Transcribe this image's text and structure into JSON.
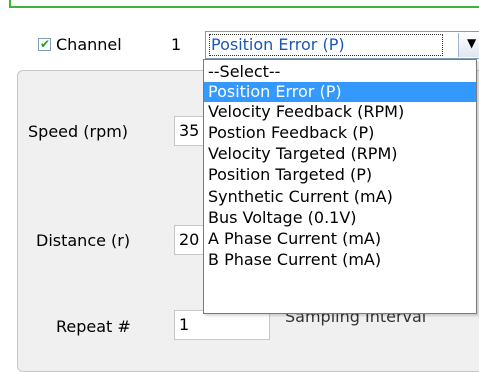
{
  "channel": {
    "checked": true,
    "label": "Channel",
    "number": "1",
    "selected_value": "Position Error (P)"
  },
  "dropdown": {
    "options": [
      "--Select--",
      "Position Error (P)",
      "Velocity Feedback (RPM)",
      "Postion Feedback (P)",
      "Velocity Targeted  (RPM)",
      "Position Targeted (P)",
      "Synthetic Current (mA)",
      "Bus Voltage (0.1V)",
      "A Phase Current (mA)",
      "B Phase Current (mA)"
    ],
    "highlighted_index": 1
  },
  "fields": {
    "speed_label": "Speed (rpm)",
    "speed_value": "35",
    "distance_label": "Distance (r)",
    "distance_value": "20",
    "repeat_label": "Repeat #",
    "repeat_value": "1",
    "sampling_label": "Sampling Interval"
  },
  "colors": {
    "accent_green": "#3cb43c",
    "selection_blue": "#3399ff",
    "selected_text": "#1b57b8"
  },
  "icons": {
    "checkbox_mark": "check-icon",
    "dropdown_arrow": "chevron-down-icon"
  }
}
